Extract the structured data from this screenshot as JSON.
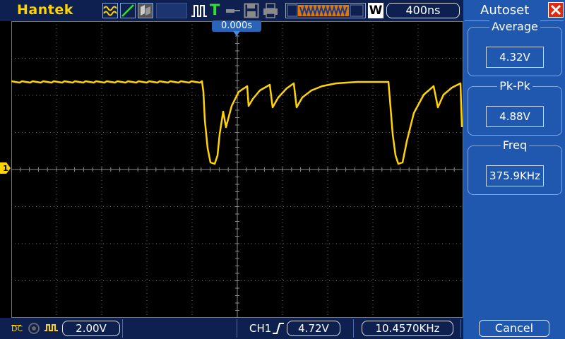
{
  "brand": "Hantek",
  "top_bar": {
    "timebase": "400ns",
    "waveform_mode_letter": "W",
    "trigger_letter": "T"
  },
  "trigger_position": "0.000s",
  "channel_marker": "1",
  "bottom_bar": {
    "coupling": "DC",
    "volts_per_div": "2.00V",
    "trigger_source": "CH1",
    "trigger_level": "4.72V",
    "frequency": "10.4570KHz"
  },
  "panel": {
    "title": "Autoset",
    "close_glyph": "X",
    "groups": [
      {
        "title": "Average",
        "value": "4.32V"
      },
      {
        "title": "Pk-Pk",
        "value": "4.88V"
      },
      {
        "title": "Freq",
        "value": "375.9KHz"
      }
    ],
    "cancel_label": "Cancel"
  },
  "colors": {
    "trace": "#ffd400",
    "bar_bg": "#0d2050",
    "panel_bg": "#2058b0",
    "grid": "#6a6a6a",
    "close": "#e02a10"
  }
}
